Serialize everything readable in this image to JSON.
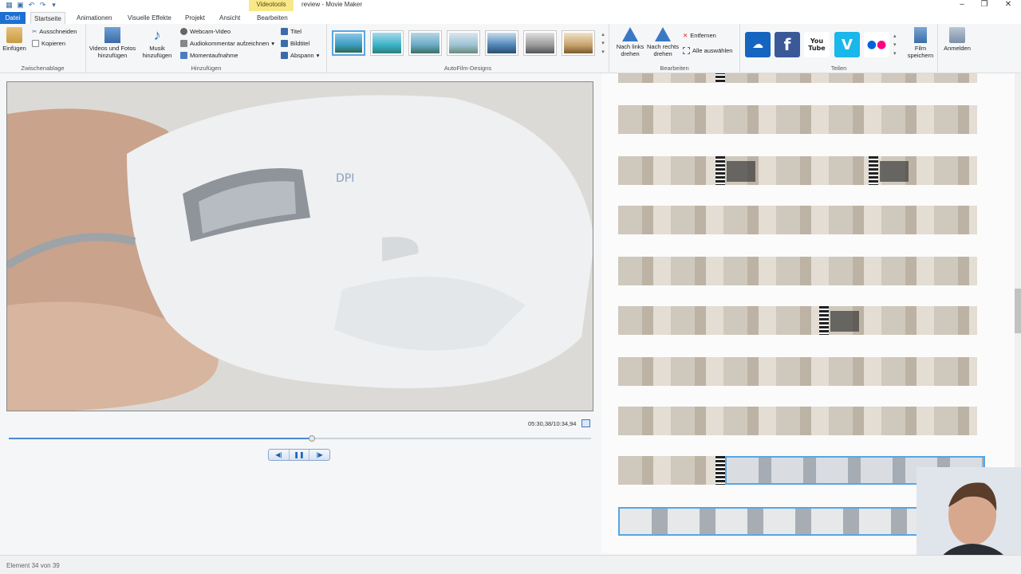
{
  "window": {
    "title": "review - Movie Maker",
    "context_tab": "Videotools",
    "minimize": "–",
    "restore": "❐",
    "close": "✕"
  },
  "tabs": [
    "Datei",
    "Startseite",
    "Animationen",
    "Visuelle Effekte",
    "Projekt",
    "Ansicht",
    "Bearbeiten"
  ],
  "ribbon": {
    "clipboard": {
      "paste": "Einfügen",
      "cut": "Ausschneiden",
      "copy": "Kopieren",
      "label": "Zwischenablage"
    },
    "add": {
      "videos_photos": "Videos und Fotos hinzufügen",
      "music": "Musik hinzufügen",
      "webcam": "Webcam-Video",
      "narration": "Audiokommentar aufzeichnen",
      "snapshot": "Momentaufnahme",
      "title": "Titel",
      "caption": "Bildtitel",
      "credits": "Abspann",
      "label": "Hinzufügen"
    },
    "autofilm": {
      "label": "AutoFilm-Designs"
    },
    "edit": {
      "rotate_left": "Nach links drehen",
      "rotate_right": "Nach rechts drehen",
      "remove": "Entfernen",
      "select_all": "Alle auswählen",
      "label": "Bearbeiten"
    },
    "share": {
      "label": "Teilen",
      "youtube": "You Tube",
      "save_movie": "Film speichern",
      "signin": "Anmelden"
    }
  },
  "player": {
    "time": "05:30,38/10:34,94",
    "progress": 0.52,
    "prev": "◀|",
    "pause": "❚❚",
    "next": "|▶"
  },
  "status": {
    "text": "Element 34 von 39"
  },
  "colors": {
    "accent": "#1d6fd1",
    "selection": "#57a6e4",
    "context_tab": "#f7e98a"
  }
}
